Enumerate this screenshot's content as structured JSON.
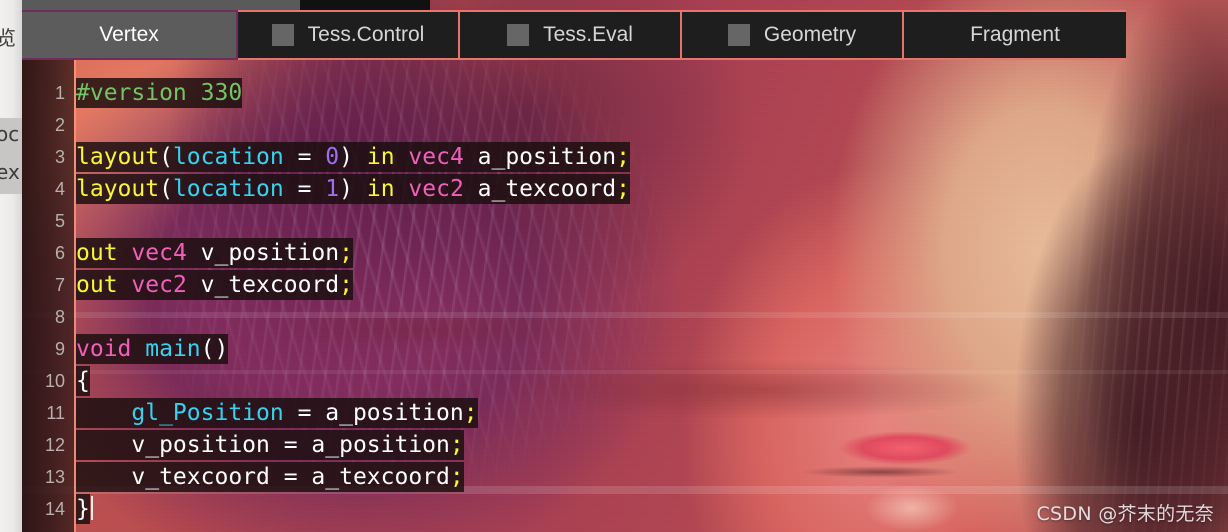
{
  "left_rail": {
    "cells": [
      {
        "text": "览"
      },
      {
        "text": "oc"
      },
      {
        "text": "ex"
      }
    ]
  },
  "tabs": {
    "items": [
      {
        "label": "Vertex",
        "active": true,
        "has_checkbox": false
      },
      {
        "label": "Tess.Control",
        "active": false,
        "has_checkbox": true
      },
      {
        "label": "Tess.Eval",
        "active": false,
        "has_checkbox": true
      },
      {
        "label": "Geometry",
        "active": false,
        "has_checkbox": true
      },
      {
        "label": "Fragment",
        "active": false,
        "has_checkbox": false
      }
    ]
  },
  "editor": {
    "language": "glsl",
    "gutter_numbers": [
      "1",
      "2",
      "3",
      "4",
      "5",
      "6",
      "7",
      "8",
      "9",
      "10",
      "11",
      "12",
      "13",
      "14"
    ],
    "cursor_line": 14,
    "cursor_column": 2,
    "lines": [
      {
        "n": 1,
        "text": "#version 330",
        "tokens": [
          {
            "t": "#version 330",
            "c": "c-pre"
          }
        ]
      },
      {
        "n": 2,
        "text": "",
        "tokens": []
      },
      {
        "n": 3,
        "text": "layout(location = 0) in vec4 a_position;",
        "tokens": [
          {
            "t": "layout",
            "c": "c-kw"
          },
          {
            "t": "(",
            "c": "c-punct"
          },
          {
            "t": "location",
            "c": "c-attr"
          },
          {
            "t": " = ",
            "c": "c-punct"
          },
          {
            "t": "0",
            "c": "c-num"
          },
          {
            "t": ") ",
            "c": "c-punct"
          },
          {
            "t": "in",
            "c": "c-kw"
          },
          {
            "t": " ",
            "c": "c-punct"
          },
          {
            "t": "vec4",
            "c": "c-type"
          },
          {
            "t": " a_position",
            "c": "c-ident"
          },
          {
            "t": ";",
            "c": "c-semi"
          }
        ]
      },
      {
        "n": 4,
        "text": "layout(location = 1) in vec2 a_texcoord;",
        "tokens": [
          {
            "t": "layout",
            "c": "c-kw"
          },
          {
            "t": "(",
            "c": "c-punct"
          },
          {
            "t": "location",
            "c": "c-attr"
          },
          {
            "t": " = ",
            "c": "c-punct"
          },
          {
            "t": "1",
            "c": "c-num"
          },
          {
            "t": ") ",
            "c": "c-punct"
          },
          {
            "t": "in",
            "c": "c-kw"
          },
          {
            "t": " ",
            "c": "c-punct"
          },
          {
            "t": "vec2",
            "c": "c-type"
          },
          {
            "t": " a_texcoord",
            "c": "c-ident"
          },
          {
            "t": ";",
            "c": "c-semi"
          }
        ]
      },
      {
        "n": 5,
        "text": "",
        "tokens": []
      },
      {
        "n": 6,
        "text": "out vec4 v_position;",
        "tokens": [
          {
            "t": "out",
            "c": "c-kw"
          },
          {
            "t": " ",
            "c": "c-punct"
          },
          {
            "t": "vec4",
            "c": "c-type"
          },
          {
            "t": " v_position",
            "c": "c-ident"
          },
          {
            "t": ";",
            "c": "c-semi"
          }
        ]
      },
      {
        "n": 7,
        "text": "out vec2 v_texcoord;",
        "tokens": [
          {
            "t": "out",
            "c": "c-kw"
          },
          {
            "t": " ",
            "c": "c-punct"
          },
          {
            "t": "vec2",
            "c": "c-type"
          },
          {
            "t": " v_texcoord",
            "c": "c-ident"
          },
          {
            "t": ";",
            "c": "c-semi"
          }
        ]
      },
      {
        "n": 8,
        "text": "",
        "tokens": []
      },
      {
        "n": 9,
        "text": "void main()",
        "tokens": [
          {
            "t": "void",
            "c": "c-type"
          },
          {
            "t": " ",
            "c": "c-punct"
          },
          {
            "t": "main",
            "c": "c-func"
          },
          {
            "t": "()",
            "c": "c-punct"
          }
        ]
      },
      {
        "n": 10,
        "text": "{",
        "tokens": [
          {
            "t": "{",
            "c": "c-punct"
          }
        ]
      },
      {
        "n": 11,
        "text": "    gl_Position = a_position;",
        "tokens": [
          {
            "t": "    ",
            "c": "c-punct"
          },
          {
            "t": "gl_Position",
            "c": "c-func"
          },
          {
            "t": " = a_position",
            "c": "c-ident"
          },
          {
            "t": ";",
            "c": "c-semi"
          }
        ]
      },
      {
        "n": 12,
        "text": "    v_position = a_position;",
        "tokens": [
          {
            "t": "    v_position = a_position",
            "c": "c-ident"
          },
          {
            "t": ";",
            "c": "c-semi"
          }
        ]
      },
      {
        "n": 13,
        "text": "    v_texcoord = a_texcoord;",
        "tokens": [
          {
            "t": "    v_texcoord = a_texcoord",
            "c": "c-ident"
          },
          {
            "t": ";",
            "c": "c-semi"
          }
        ]
      },
      {
        "n": 14,
        "text": "}",
        "tokens": [
          {
            "t": "}",
            "c": "c-punct"
          }
        ]
      }
    ]
  },
  "watermark": {
    "text": "CSDN @芥末的无奈"
  },
  "colors": {
    "tab_active_bg": "#5c5c5c",
    "tab_inactive_bg": "#1e1e1e",
    "tab_border": "#e8746e",
    "tab_border_active": "#6d2e5e",
    "checkbox": "#666666",
    "gutter_text": "#b9b0ad",
    "separator": "#f5967d",
    "code_highlight_bg": "rgba(26,14,14,0.84)",
    "preprocessor": "#73c563",
    "keyword": "#f7f736",
    "type": "#f25fbb",
    "identifier": "#ffffff",
    "attribute": "#35d3ef",
    "number": "#9d6ff0",
    "builtin": "#35d3ef"
  }
}
